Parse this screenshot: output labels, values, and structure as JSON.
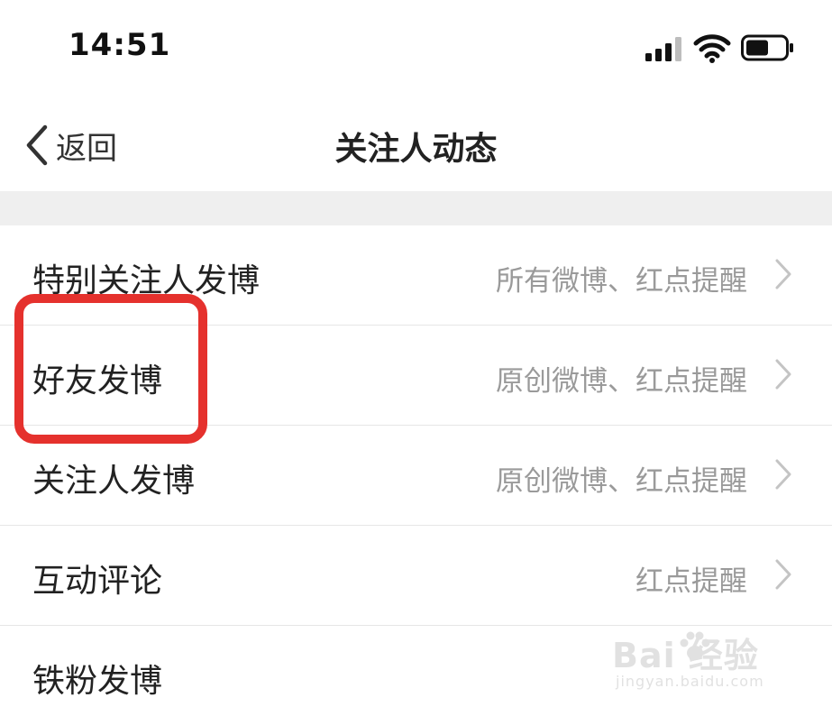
{
  "status_bar": {
    "time": "14:51"
  },
  "nav": {
    "back_label": "返回",
    "title": "关注人动态"
  },
  "settings": [
    {
      "label": "特别关注人发博",
      "value": "所有微博、红点提醒"
    },
    {
      "label": "好友发博",
      "value": "原创微博、红点提醒"
    },
    {
      "label": "关注人发博",
      "value": "原创微博、红点提醒"
    },
    {
      "label": "互动评论",
      "value": "红点提醒"
    },
    {
      "label": "铁粉发博",
      "value": ""
    }
  ],
  "annotation": {
    "color": "#e5312d"
  },
  "watermark": {
    "logo": "Bai  经验",
    "url": "jingyan.baidu.com"
  },
  "icons": {
    "signal": "cellular-signal-icon",
    "wifi": "wifi-icon",
    "battery": "battery-icon",
    "back": "chevron-left-icon",
    "row": "chevron-right-icon"
  }
}
